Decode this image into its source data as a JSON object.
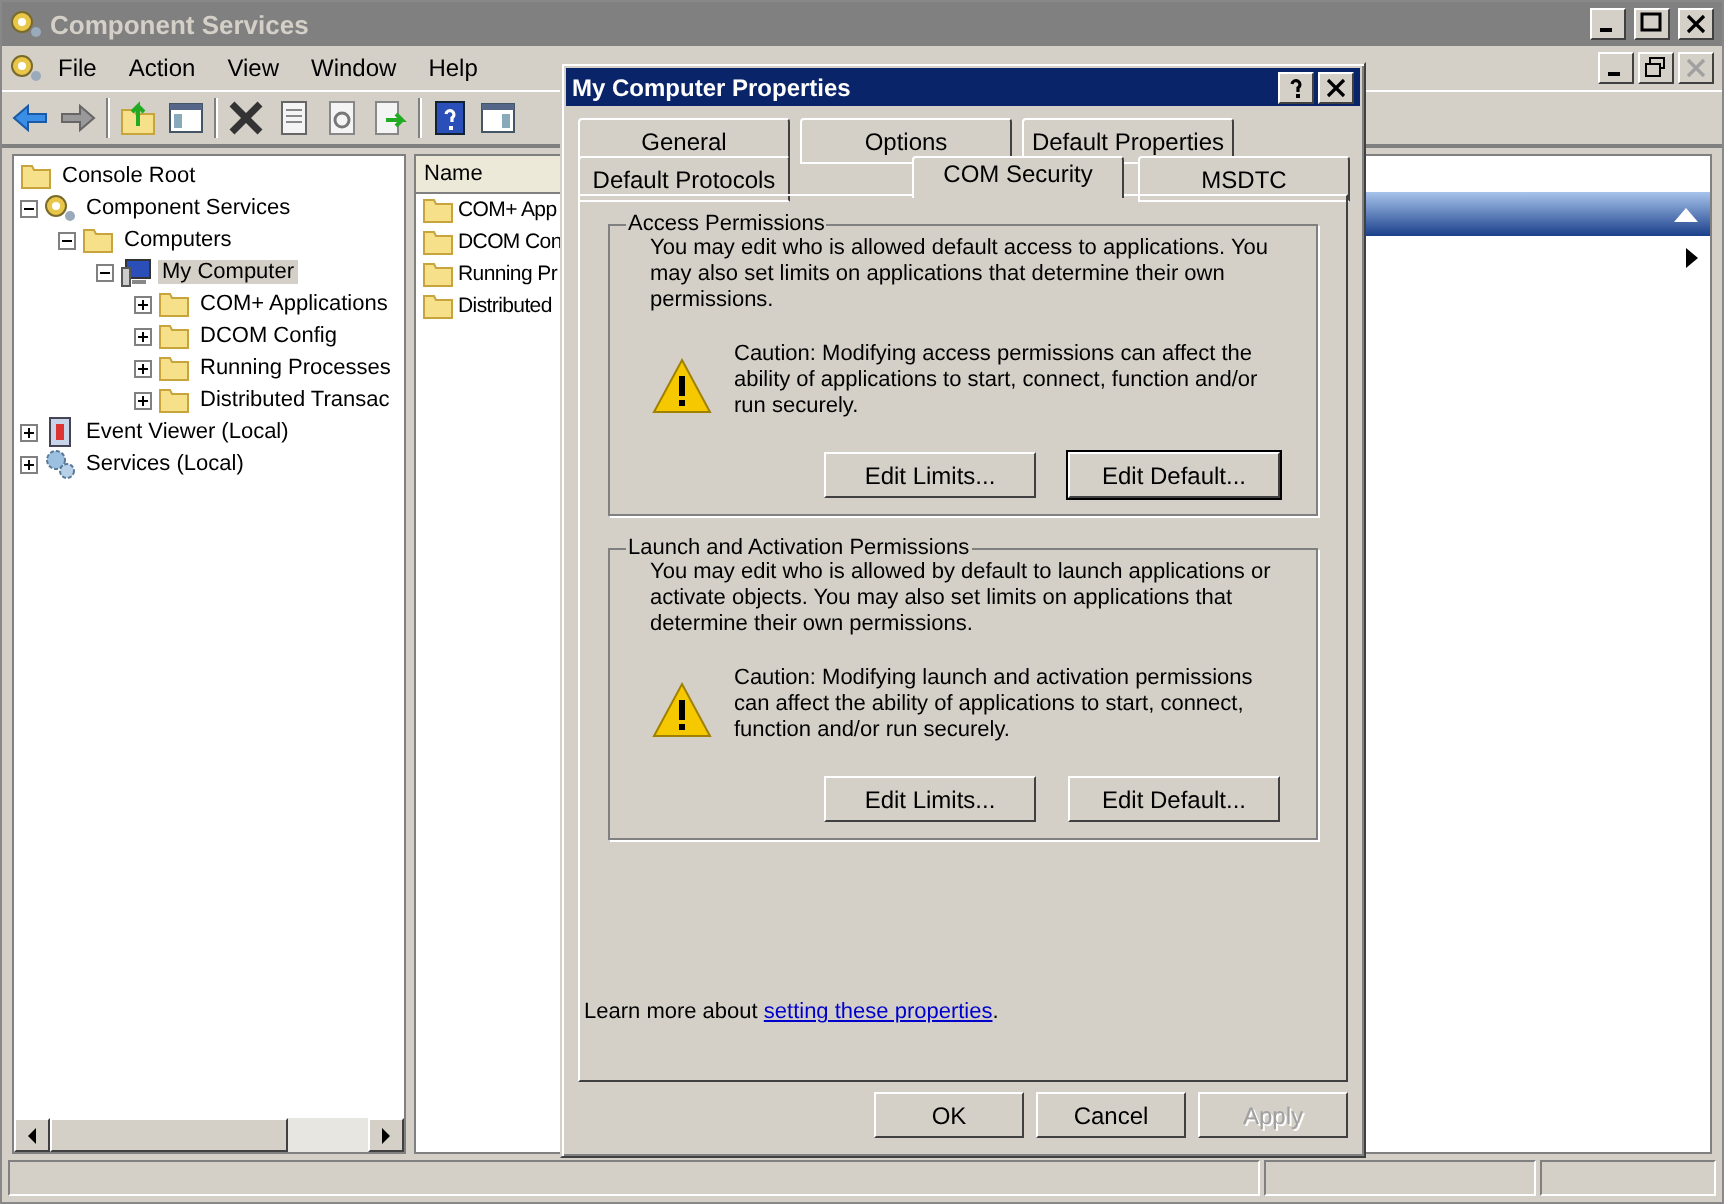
{
  "window": {
    "title": "Component Services"
  },
  "menu": [
    "File",
    "Action",
    "View",
    "Window",
    "Help"
  ],
  "tree": [
    {
      "label": "Console Root",
      "kind": "folder",
      "selected": false,
      "children": [
        {
          "label": "Component Services",
          "kind": "component",
          "expanded": true,
          "selected": false,
          "children": [
            {
              "label": "Computers",
              "kind": "folder",
              "expanded": true,
              "selected": false,
              "children": [
                {
                  "label": "My Computer",
                  "kind": "computer",
                  "expanded": true,
                  "selected": true,
                  "children": [
                    {
                      "label": "COM+ Applications",
                      "kind": "folder",
                      "expanded": false,
                      "selected": false
                    },
                    {
                      "label": "DCOM Config",
                      "kind": "folder",
                      "expanded": false,
                      "selected": false
                    },
                    {
                      "label": "Running Processes",
                      "kind": "folder",
                      "expanded": false,
                      "selected": false
                    },
                    {
                      "label": "Distributed Transac",
                      "kind": "folder",
                      "expanded": false,
                      "selected": false
                    }
                  ]
                }
              ]
            }
          ]
        },
        {
          "label": "Event Viewer (Local)",
          "kind": "log",
          "expanded": false,
          "selected": false
        },
        {
          "label": "Services (Local)",
          "kind": "gears",
          "expanded": false,
          "selected": false
        }
      ]
    }
  ],
  "list": {
    "column": "Name",
    "items": [
      "COM+ App",
      "DCOM Con",
      "Running Pr",
      "Distributed"
    ]
  },
  "dialog": {
    "title": "My Computer Properties",
    "tab_rows": [
      [
        {
          "label": "General",
          "selected": false
        },
        {
          "label": "Options",
          "selected": false
        },
        {
          "label": "Default Properties",
          "selected": false
        }
      ],
      [
        {
          "label": "Default Protocols",
          "selected": false
        },
        {
          "label": "COM Security",
          "selected": true
        },
        {
          "label": "MSDTC",
          "selected": false
        }
      ]
    ],
    "groups": [
      {
        "title": "Access Permissions",
        "text": "You may edit who is allowed default access to applications. You may also set limits on applications that determine their own permissions.",
        "caution": "Caution: Modifying access permissions can affect the ability of applications to start, connect, function and/or run securely.",
        "buttons": [
          {
            "label": "Edit Limits...",
            "default": false
          },
          {
            "label": "Edit Default...",
            "default": true
          }
        ]
      },
      {
        "title": "Launch and Activation Permissions",
        "text": "You may edit who is allowed by default to launch applications or activate objects. You may also set limits on applications that determine their own permissions.",
        "caution": "Caution: Modifying launch and activation permissions can affect the ability of applications to start, connect, function and/or run securely.",
        "buttons": [
          {
            "label": "Edit Limits...",
            "default": false
          },
          {
            "label": "Edit Default...",
            "default": false
          }
        ]
      }
    ],
    "learn_more": {
      "text": "Learn more about ",
      "link": "setting these properties",
      "end": "."
    },
    "buttons": [
      {
        "label": "OK",
        "disabled": false
      },
      {
        "label": "Cancel",
        "disabled": false
      },
      {
        "label": "Apply",
        "disabled": true
      }
    ]
  }
}
